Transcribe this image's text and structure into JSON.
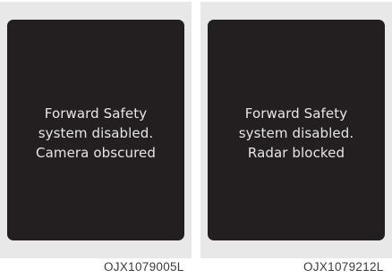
{
  "panels": [
    {
      "lines": [
        "Forward Safety",
        "system disabled.",
        "Camera obscured"
      ],
      "code": "OJX1079005L"
    },
    {
      "lines": [
        "Forward Safety",
        "system disabled.",
        "Radar blocked"
      ],
      "code": "OJX1079212L"
    }
  ],
  "colors": {
    "screen_background": "#231f20",
    "screen_text": "#e6e6e6",
    "panel_background": "#e8e8e8"
  }
}
